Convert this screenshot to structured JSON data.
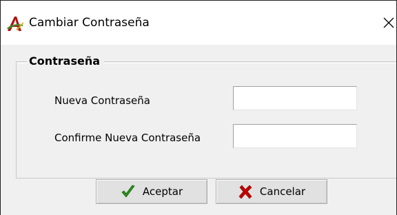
{
  "window": {
    "title": "Cambiar Contraseña",
    "close_glyph": "✕"
  },
  "group": {
    "legend": "Contraseña"
  },
  "fields": {
    "new_password": {
      "label": "Nueva Contraseña",
      "value": ""
    },
    "confirm_password": {
      "label": "Confirme Nueva Contraseña",
      "value": ""
    }
  },
  "buttons": {
    "accept_label": "Aceptar",
    "cancel_label": "Cancelar"
  },
  "icons": {
    "app": "app-logo-icon",
    "accept": "checkmark-icon",
    "cancel": "x-mark-icon"
  },
  "colors": {
    "accept_green": "#2e8b1f",
    "cancel_red": "#c00000",
    "app_red": "#b01010"
  }
}
